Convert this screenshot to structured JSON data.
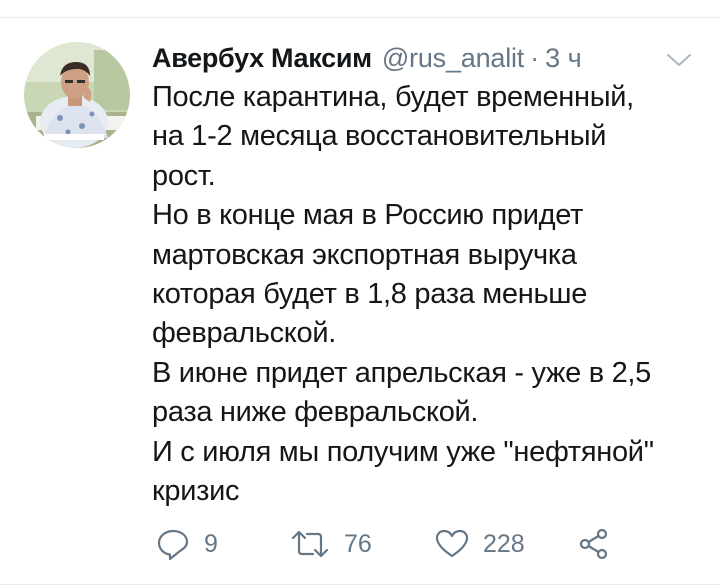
{
  "tweet": {
    "author_name": "Авербух Максим",
    "author_handle": "@rus_analit",
    "separator": "·",
    "time": "3 ч",
    "text_lines": [
      "После карантина, будет временный,",
      "на 1-2 месяца восстановительный",
      "рост.",
      "Но в конце мая в Россию придет",
      "мартовская экспортная выручка",
      "которая будет в 1,8 раза меньше",
      "февральской.",
      "В июне придет апрельская - уже в 2,5",
      "раза ниже февральской.",
      "И с июля мы получим уже \"нефтяной\"",
      "кризис"
    ]
  },
  "actions": {
    "reply_count": "9",
    "retweet_count": "76",
    "like_count": "228"
  },
  "icons": {
    "reply": "speech-bubble",
    "retweet": "retweet-arrows",
    "like": "heart-outline",
    "share": "share-nodes",
    "menu": "chevron-down"
  },
  "colors": {
    "text": "#14171a",
    "secondary": "#657786",
    "divider": "#e6ecf0"
  }
}
